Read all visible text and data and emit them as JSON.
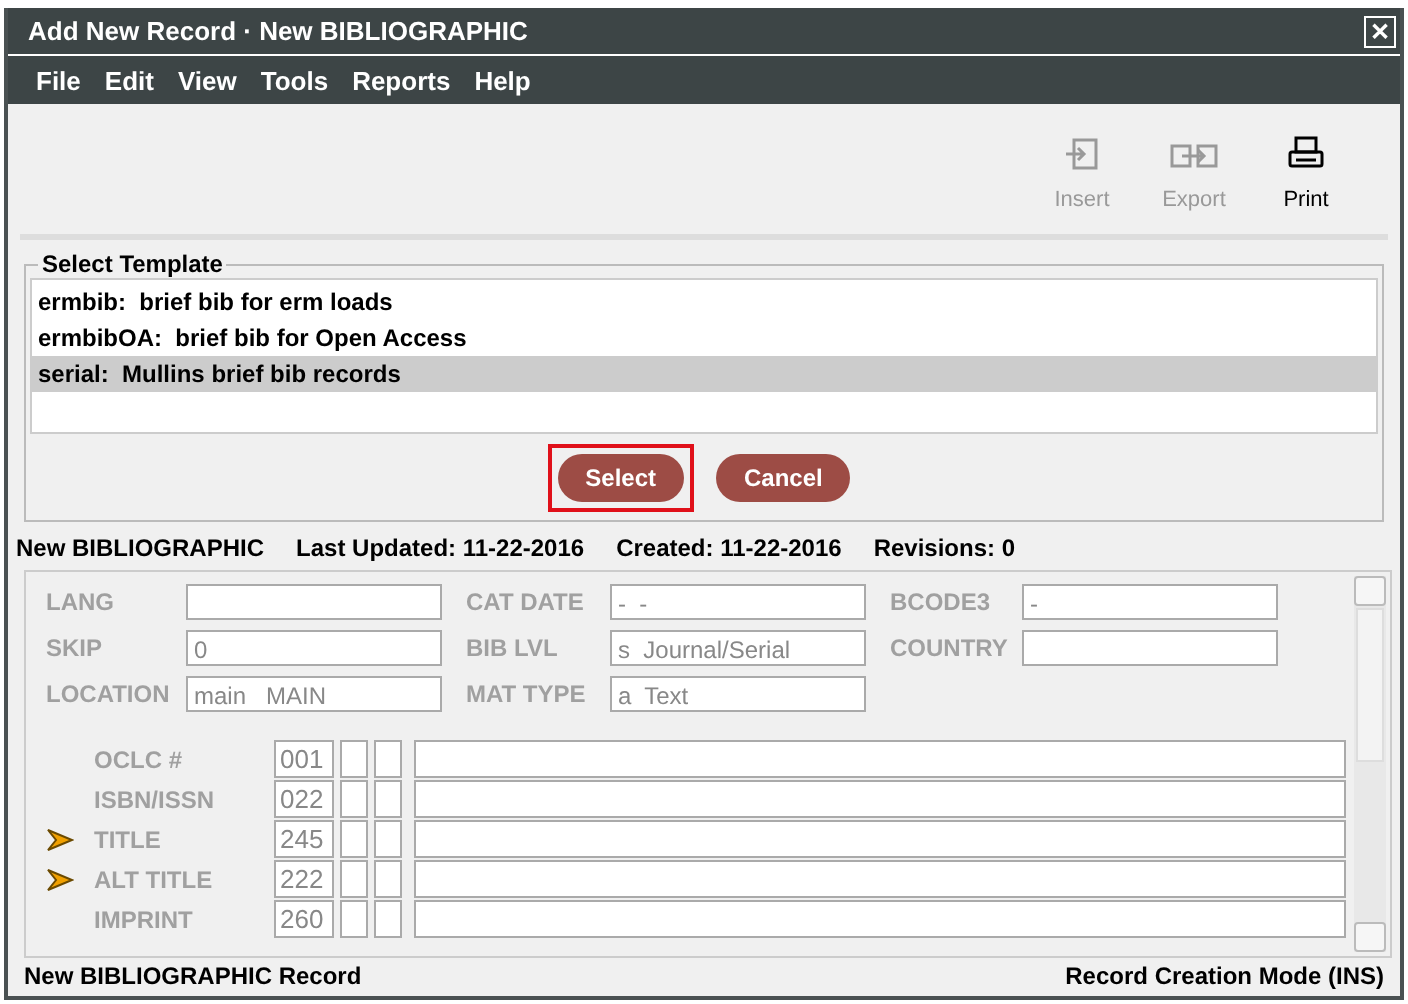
{
  "window": {
    "title": "Add New Record · New BIBLIOGRAPHIC",
    "close_glyph": "✕"
  },
  "menu": [
    "File",
    "Edit",
    "View",
    "Tools",
    "Reports",
    "Help"
  ],
  "toolbar": [
    {
      "kind": "insert",
      "label": "Insert",
      "disabled": true
    },
    {
      "kind": "export",
      "label": "Export",
      "disabled": true
    },
    {
      "kind": "print",
      "label": "Print",
      "disabled": false
    }
  ],
  "template_panel": {
    "title": "Select Template",
    "items": [
      {
        "name": "ermbib:",
        "description": "brief bib for erm loads",
        "selected": false
      },
      {
        "name": "ermbibOA:",
        "description": "brief bib for Open Access",
        "selected": false
      },
      {
        "name": "serial:",
        "description": "Mullins brief bib records",
        "selected": true
      }
    ],
    "buttons": [
      {
        "label": "Select",
        "highlighted": true
      },
      {
        "label": "Cancel",
        "highlighted": false
      }
    ]
  },
  "record_info": [
    "New BIBLIOGRAPHIC",
    "Last Updated: 11-22-2016",
    "Created: 11-22-2016",
    "Revisions: 0"
  ],
  "fixed_fields": [
    {
      "label": "LANG"
    },
    {
      "label": "CAT DATE",
      "value": "-  -"
    },
    {
      "label": "BCODE3",
      "value": "-"
    },
    {
      "label": "SKIP",
      "value": "0"
    },
    {
      "label": "BIB LVL",
      "value": "s  Journal/Serial"
    },
    {
      "label": "COUNTRY"
    },
    {
      "label": "LOCATION",
      "value": "main   MAIN"
    },
    {
      "label": "MAT TYPE",
      "value": "a  Text"
    }
  ],
  "variable_fields": [
    {
      "label": "OCLC #",
      "tag": "001",
      "marked": false
    },
    {
      "label": "ISBN/ISSN",
      "tag": "022",
      "marked": false
    },
    {
      "label": "TITLE",
      "tag": "245",
      "marked": true
    },
    {
      "label": "ALT TITLE",
      "tag": "222",
      "marked": true
    },
    {
      "label": "IMPRINT",
      "tag": "260",
      "marked": false
    }
  ],
  "status_bar": {
    "left": "New BIBLIOGRAPHIC Record",
    "right": "Record Creation Mode (INS)"
  }
}
